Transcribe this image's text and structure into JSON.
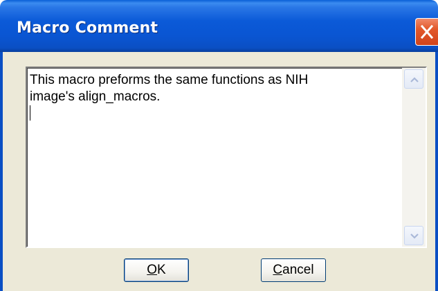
{
  "window": {
    "title": "Macro Comment",
    "close_icon": "close-x-icon",
    "accent_color": "#0a55d2",
    "close_color": "#e2582b"
  },
  "comment": {
    "text": "This macro preforms the same functions as NIH\nimage's align_macros.\n"
  },
  "scrollbar": {
    "up_icon": "chevron-up-icon",
    "down_icon": "chevron-down-icon"
  },
  "buttons": {
    "ok": {
      "accel": "O",
      "rest": "K"
    },
    "cancel": {
      "accel": "C",
      "rest": "ancel"
    }
  }
}
